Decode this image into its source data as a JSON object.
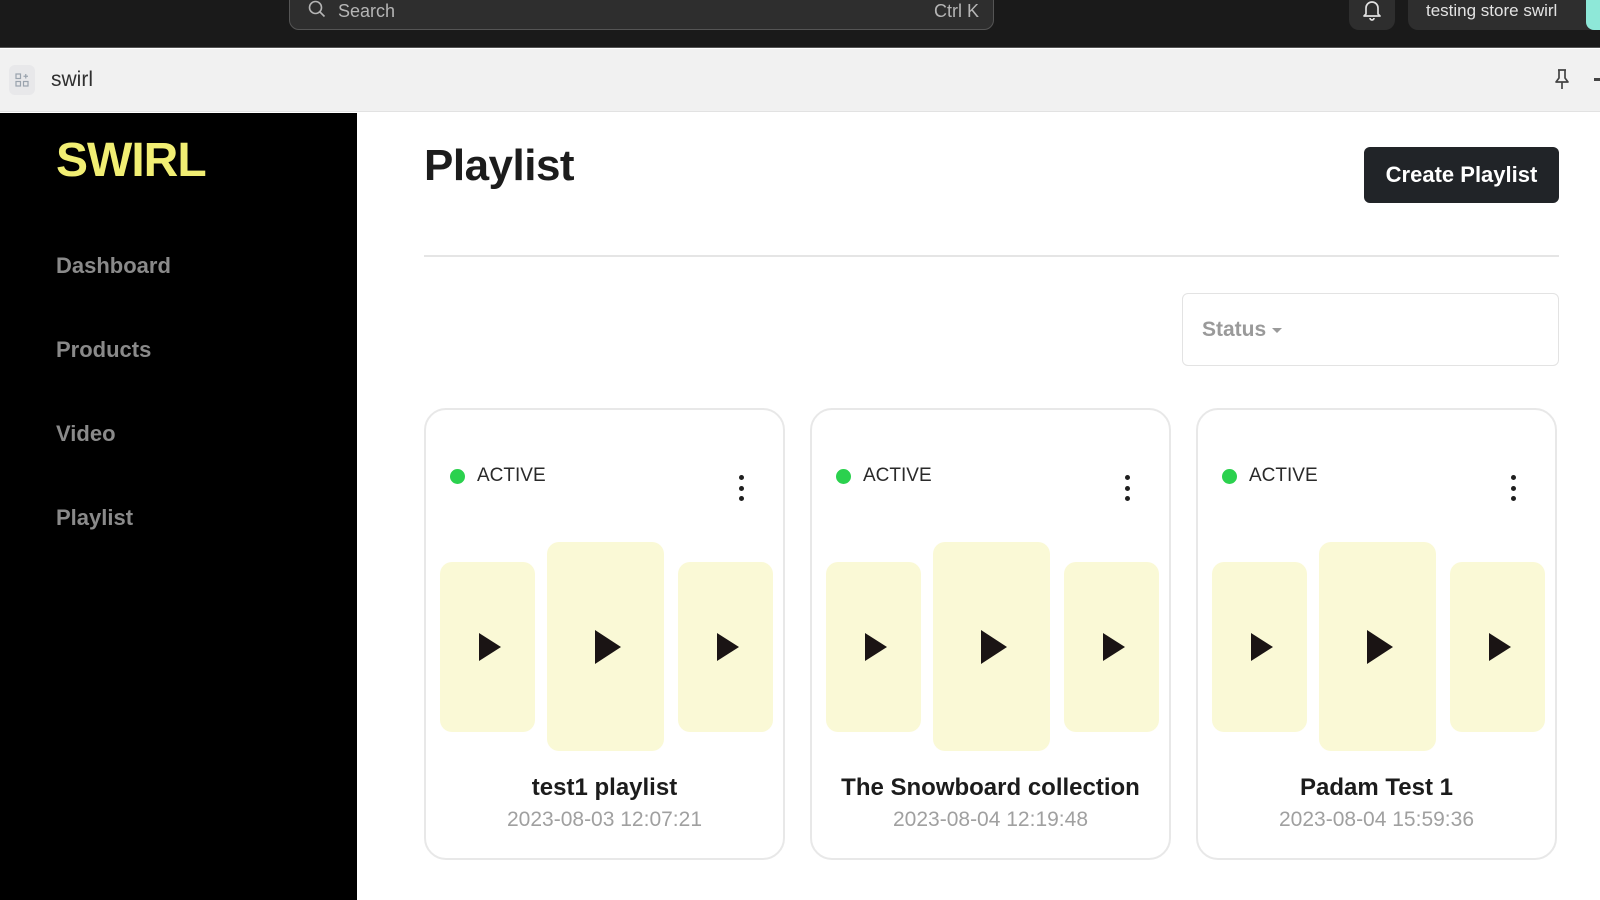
{
  "topbar": {
    "search_placeholder": "Search",
    "search_shortcut": "Ctrl K",
    "store_name": "testing store swirl"
  },
  "appbar": {
    "app_name": "swirl"
  },
  "sidebar": {
    "logo": "SWIRL",
    "logo_color": "#f1ee73",
    "items": [
      {
        "label": "Dashboard"
      },
      {
        "label": "Products"
      },
      {
        "label": "Video"
      },
      {
        "label": "Playlist"
      }
    ]
  },
  "main": {
    "title": "Playlist",
    "create_button": "Create Playlist",
    "status_filter_label": "Status",
    "playlists": [
      {
        "status": "ACTIVE",
        "name": "test1 playlist",
        "date": "2023-08-03 12:07:21"
      },
      {
        "status": "ACTIVE",
        "name": "The Snowboard collection",
        "date": "2023-08-04 12:19:48"
      },
      {
        "status": "ACTIVE",
        "name": "Padam Test 1",
        "date": "2023-08-04 15:59:36"
      }
    ],
    "status_color": "#2bd14e",
    "thumbnail_color": "#faf9d6"
  }
}
